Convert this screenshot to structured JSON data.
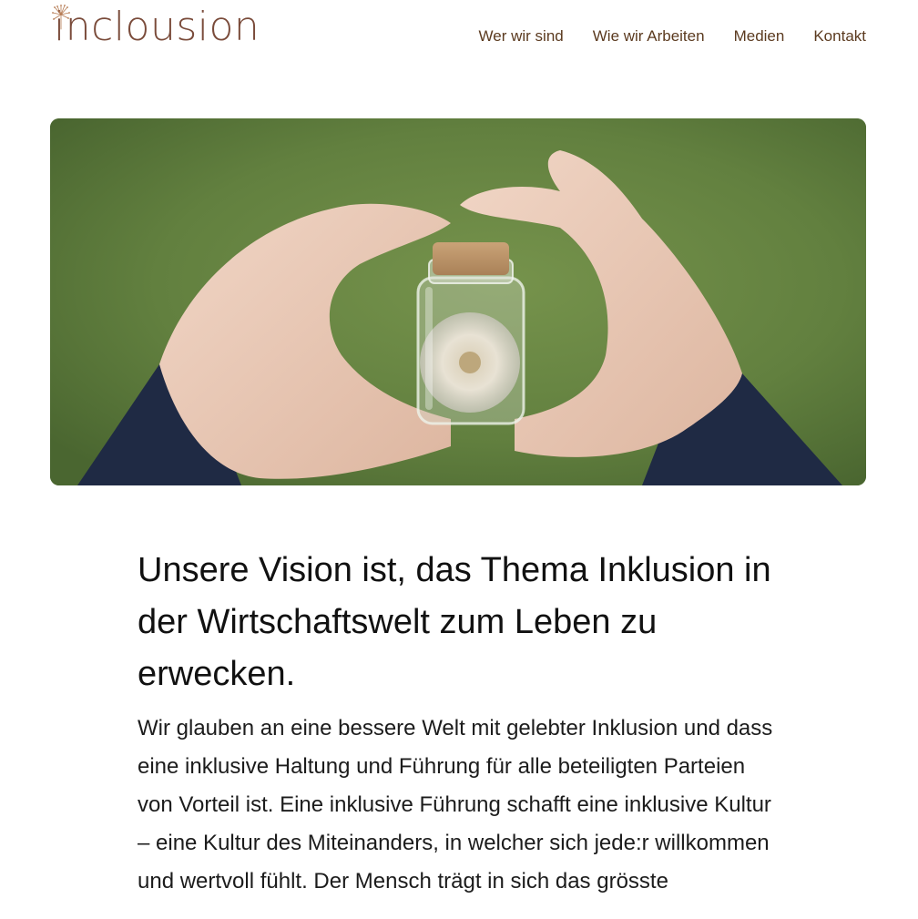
{
  "header": {
    "logo": {
      "text": "inclousion",
      "icon": "dandelion-icon"
    },
    "nav": [
      {
        "label": "Wer wir sind"
      },
      {
        "label": "Wie wir Arbeiten"
      },
      {
        "label": "Medien"
      },
      {
        "label": "Kontakt"
      }
    ]
  },
  "hero": {
    "image": "hands-holding-jar-with-dandelion-image"
  },
  "main": {
    "headline": "Unsere Vision ist, das Thema Inklusion in der Wirtschaftswelt zum Leben zu erwecken.",
    "paragraph": "Wir glauben an eine bessere Welt mit gelebter Inklusion und dass eine inklusive Haltung und Führung für alle beteiligten Parteien von Vorteil ist. Eine inklusive Führung schafft eine inklusive Kultur – eine Kultur des Miteinanders, in welcher sich jede:r willkommen und wertvoll fühlt. Der Mensch trägt in sich das grösste"
  },
  "colors": {
    "brand": "#c98a5a",
    "brand_dark": "#7a4b3a",
    "nav_text": "#5b3a1f",
    "heading_text": "#111111",
    "body_text": "#1c1c1c",
    "background": "#ffffff"
  }
}
